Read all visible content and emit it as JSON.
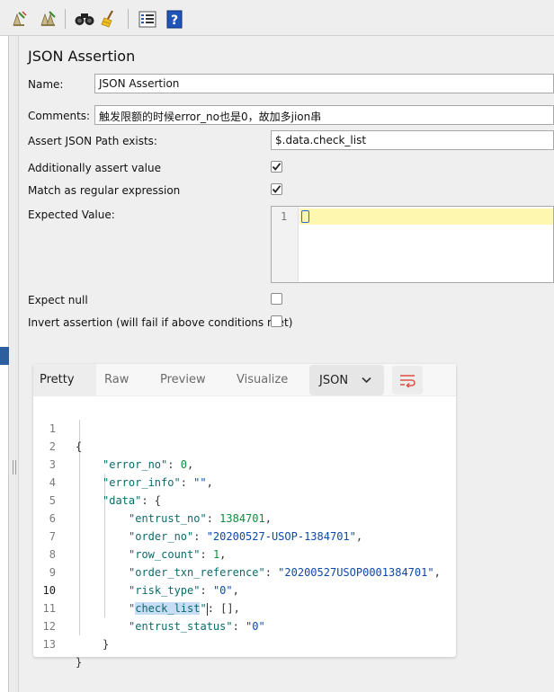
{
  "toolbar": {
    "buttons": [
      {
        "icon": "clear-icon"
      },
      {
        "icon": "clear-all-icon"
      },
      {
        "icon": "binoculars-icon"
      },
      {
        "icon": "broom-icon"
      },
      {
        "icon": "function-helper-icon"
      },
      {
        "icon": "help-icon"
      }
    ]
  },
  "panel": {
    "title": "JSON Assertion",
    "name_label": "Name:",
    "name_value": "JSON Assertion",
    "comments_label": "Comments:",
    "comments_value": "触发限额的时候error_no也是0，故加多jion串",
    "path_label": "Assert JSON Path exists:",
    "path_value": "$.data.check_list",
    "assert_value_label": "Additionally assert value",
    "assert_value_checked": true,
    "regex_label": "Match as regular expression",
    "regex_checked": true,
    "expected_label": "Expected Value:",
    "expected_line_number": "1",
    "expect_null_label": "Expect null",
    "expect_null_checked": false,
    "invert_label": "Invert assertion (will fail if above conditions met)",
    "invert_checked": false
  },
  "viewer": {
    "tabs": [
      "Pretty",
      "Raw",
      "Preview",
      "Visualize"
    ],
    "active_tab": "Pretty",
    "format": "JSON",
    "current_line": 10,
    "lines": [
      {
        "num": "1"
      },
      {
        "num": "2",
        "key": "\"error_no\"",
        "val": "0",
        "tail": ","
      },
      {
        "num": "3",
        "key": "\"error_info\"",
        "val": "\"\"",
        "tail": ","
      },
      {
        "num": "4",
        "key": "\"data\"",
        "tail": ": {"
      },
      {
        "num": "5",
        "key": "\"entrust_no\"",
        "val": "1384701",
        "tail": ","
      },
      {
        "num": "6",
        "key": "\"order_no\"",
        "val": "\"20200527-USOP-1384701\"",
        "tail": ","
      },
      {
        "num": "7",
        "key": "\"row_count\"",
        "val": "1",
        "tail": ","
      },
      {
        "num": "8",
        "key": "\"order_txn_reference\"",
        "val": "\"20200527USOP0001384701\"",
        "tail": ","
      },
      {
        "num": "9",
        "key": "\"risk_type\"",
        "val": "\"0\"",
        "tail": ","
      },
      {
        "num": "10",
        "key_quote": "\"",
        "key_sel": "check_list",
        "val": "[]",
        "tail": ","
      },
      {
        "num": "11",
        "key": "\"entrust_status\"",
        "val": "\"0\""
      },
      {
        "num": "12",
        "tail": "}"
      },
      {
        "num": "13",
        "tail": "}"
      }
    ],
    "open_brace": "{",
    "colon": ": "
  }
}
